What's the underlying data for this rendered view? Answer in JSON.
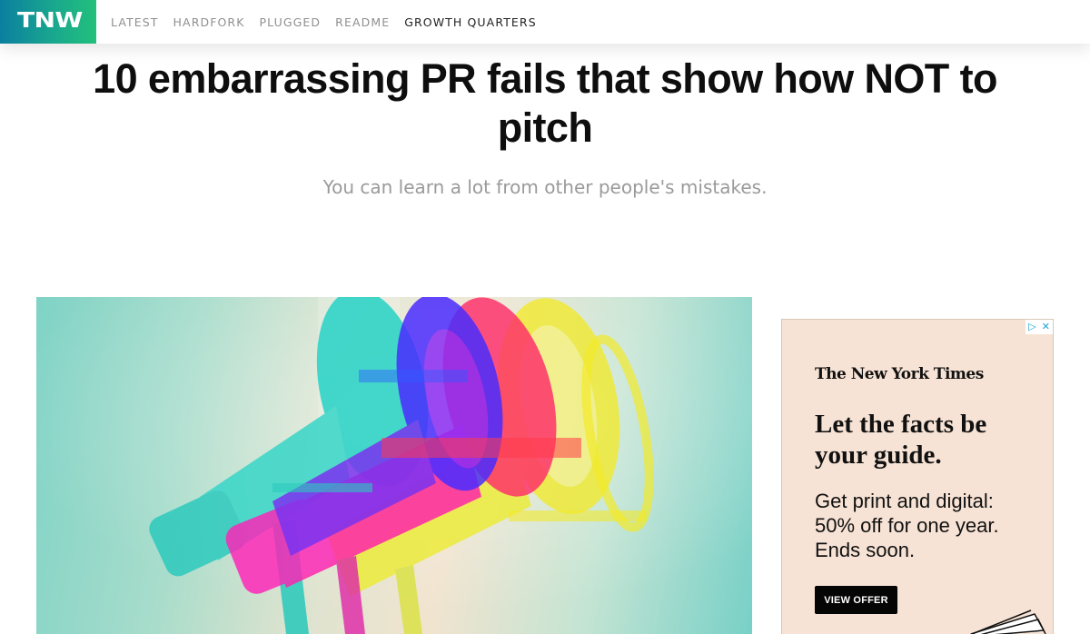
{
  "header": {
    "logo_text": "TNW",
    "nav": [
      {
        "label": "LATEST",
        "active": false
      },
      {
        "label": "HARDFORK",
        "active": false
      },
      {
        "label": "PLUGGED",
        "active": false
      },
      {
        "label": "README",
        "active": false
      },
      {
        "label": "GROWTH QUARTERS",
        "active": true
      }
    ],
    "logo_gradient": [
      "#0b7f9f",
      "#22c07c"
    ]
  },
  "article": {
    "title": "10 embarrassing PR fails that show how NOT to pitch",
    "subtitle": "You can learn a lot from other people's mistakes.",
    "hero_image": "megaphone-illustration"
  },
  "ad": {
    "choices_icons": [
      "adchoices-icon",
      "close-icon"
    ],
    "brand": "The New York Times",
    "headline": "Let the facts be your guide.",
    "offer_lines": [
      "Get print and digital:",
      "50% off for one year.",
      "Ends soon."
    ],
    "cta_label": "VIEW OFFER",
    "background_color": "#f7e3d5"
  }
}
